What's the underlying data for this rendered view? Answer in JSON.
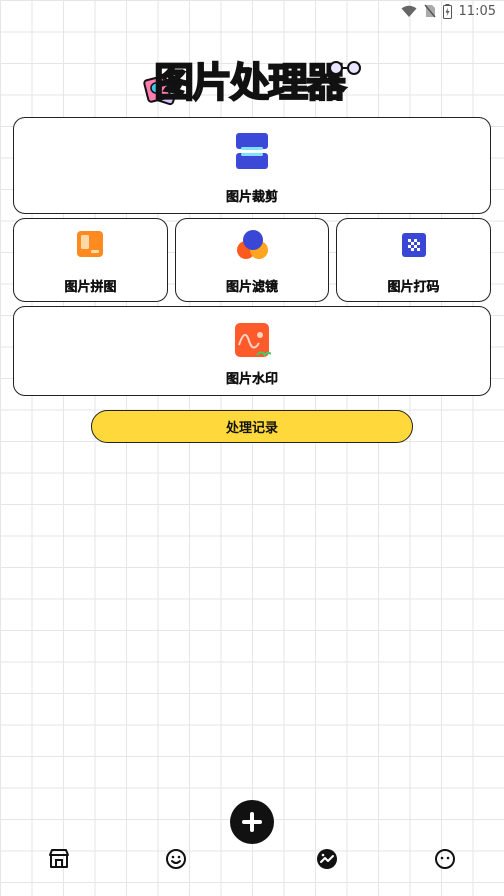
{
  "status_bar": {
    "time": "11:05",
    "icons": [
      "wifi-icon",
      "no-sim-icon",
      "battery-charging-icon"
    ]
  },
  "header": {
    "title_chars": [
      "图",
      "片",
      "处",
      "理",
      "器"
    ],
    "logo_icon": "photo-stack-icon"
  },
  "cards": {
    "crop": {
      "label": "图片裁剪",
      "icon": "crop-icon"
    },
    "collage": {
      "label": "图片拼图",
      "icon": "collage-icon"
    },
    "filter": {
      "label": "图片滤镜",
      "icon": "filter-icon"
    },
    "mosaic": {
      "label": "图片打码",
      "icon": "mosaic-icon"
    },
    "watermark": {
      "label": "图片水印",
      "icon": "watermark-icon"
    }
  },
  "history_button": {
    "label": "处理记录"
  },
  "fab": {
    "icon": "plus-icon"
  },
  "bottom_nav": [
    {
      "icon": "store-icon"
    },
    {
      "icon": "smile-icon"
    },
    {
      "icon": "process-icon"
    },
    {
      "icon": "profile-icon"
    }
  ],
  "colors": {
    "accent_yellow": "#ffd93b",
    "crop_blue": "#3b48d8",
    "collage_orange": "#ff8a1f",
    "watermark_orange": "#ff5a2c",
    "mosaic_blue": "#3a46d6"
  }
}
